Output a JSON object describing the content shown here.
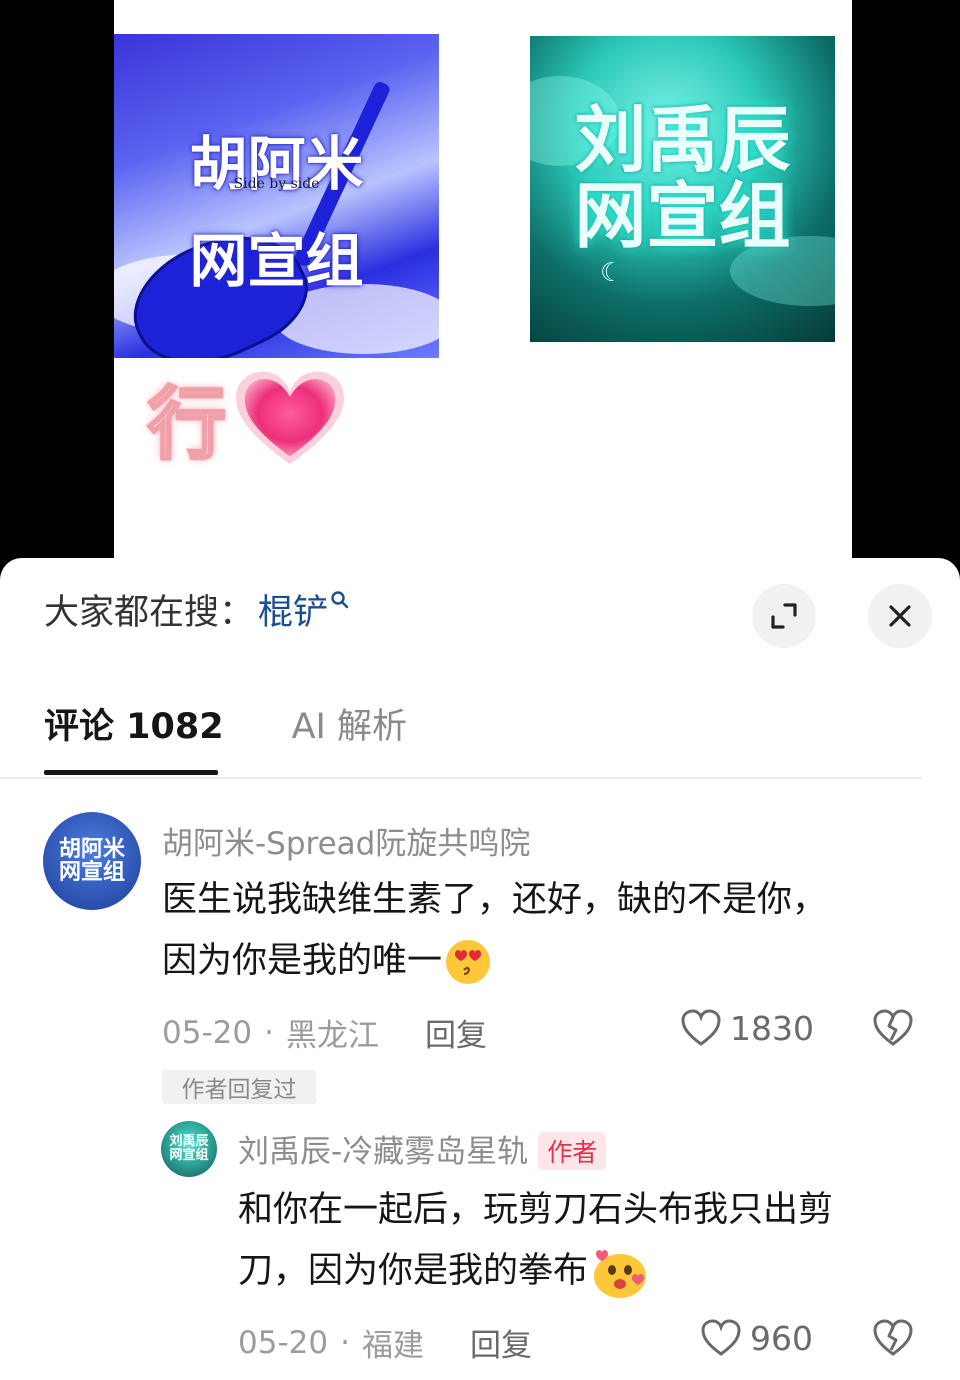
{
  "media": {
    "cover_left": {
      "line1": "胡阿米",
      "line2": "网宣组",
      "subtitle": "Side by side"
    },
    "cover_right": {
      "line1": "刘禹辰",
      "line2": "网宣组"
    },
    "sticker_text": "行"
  },
  "search": {
    "label": "大家都在搜：",
    "term": "棍铲",
    "icon": "search-icon"
  },
  "header": {
    "expand_icon": "expand-icon",
    "close_icon": "close-icon"
  },
  "tabs": [
    {
      "label": "评论 1082",
      "active": true
    },
    {
      "label": "AI 解析",
      "active": false
    }
  ],
  "comments": [
    {
      "avatar_text": "胡阿米网宣组",
      "username": "胡阿米-Spread阮旋共鸣院",
      "content_line1": "医生说我缺维生素了，还好，缺的不是你，",
      "content_line2": "因为你是我的唯一",
      "date": "05-20",
      "separator": "·",
      "location": "黑龙江",
      "reply_label": "回复",
      "likes": "1830",
      "author_replied_tag": "作者回复过"
    }
  ],
  "reply": {
    "avatar_text": "刘禹辰网宣组",
    "username": "刘禹辰-冷藏雾岛星轨",
    "author_badge": "作者",
    "content_line1": "和你在一起后，玩剪刀石头布我只出剪",
    "content_line2": "刀，因为你是我的拳布",
    "date": "05-20",
    "separator": "·",
    "location": "福建",
    "reply_label": "回复",
    "likes": "960"
  },
  "colors": {
    "link_blue": "#1a4f8f",
    "author_red": "#e5304c",
    "muted_gray": "#8d8d8d"
  }
}
